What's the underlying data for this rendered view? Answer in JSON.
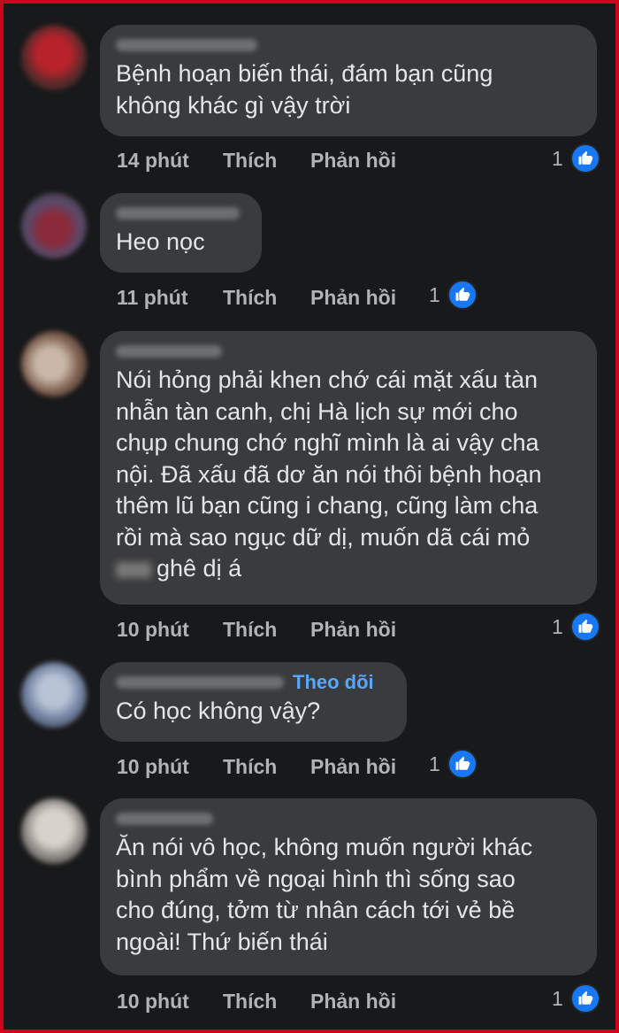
{
  "comments": [
    {
      "author": "Bao Linh Chau",
      "text": "Bệnh hoạn biến thái, đám bạn cũng\nkhông khác gì vậy trời",
      "time": "14 phút",
      "like_label": "Thích",
      "reply_label": "Phản hồi",
      "reactions": "1"
    },
    {
      "author": "Cường Nguyễn",
      "text": "Heo nọc",
      "time": "11 phút",
      "like_label": "Thích",
      "reply_label": "Phản hồi",
      "reactions": "1"
    },
    {
      "author": "Khanh Linh",
      "text": "Nói hỏng phải khen chớ cái mặt xấu tàn\nnhẫn tàn canh, chị Hà lịch sự mới cho\nchụp chung chớ nghĩ mình là ai vậy cha\nnội. Đã xấu đã dơ ăn nói thôi bệnh hoạn\nthêm lũ bạn cũng i chang, cũng làm cha\nrồi mà sao ngục dữ dị, muốn dã cái mỏ",
      "text_last": "ghê dị á",
      "time": "10 phút",
      "like_label": "Thích",
      "reply_label": "Phản hồi",
      "reactions": "1"
    },
    {
      "author": "Nguyễn Anh Liên",
      "follow_label": "Theo dõi",
      "text": "Có học không vậy?",
      "time": "10 phút",
      "like_label": "Thích",
      "reply_label": "Phản hồi",
      "reactions": "1"
    },
    {
      "author": "Thanh Trúc",
      "text": "Ăn nói vô học, không muốn người khác\nbình phẩm về ngoại hình thì sống sao\ncho đúng, tởm từ nhân cách tới vẻ bề\nngoài! Thứ biến thái",
      "time": "10 phút",
      "like_label": "Thích",
      "reply_label": "Phản hồi",
      "reactions": "1"
    }
  ],
  "colors": {
    "background": "#18191a",
    "bubble": "#3a3b3c",
    "link": "#5aa7ff",
    "like_badge": "#1877f2",
    "frame": "#d0021b"
  },
  "icons": {
    "reaction": "like-thumb-icon"
  }
}
